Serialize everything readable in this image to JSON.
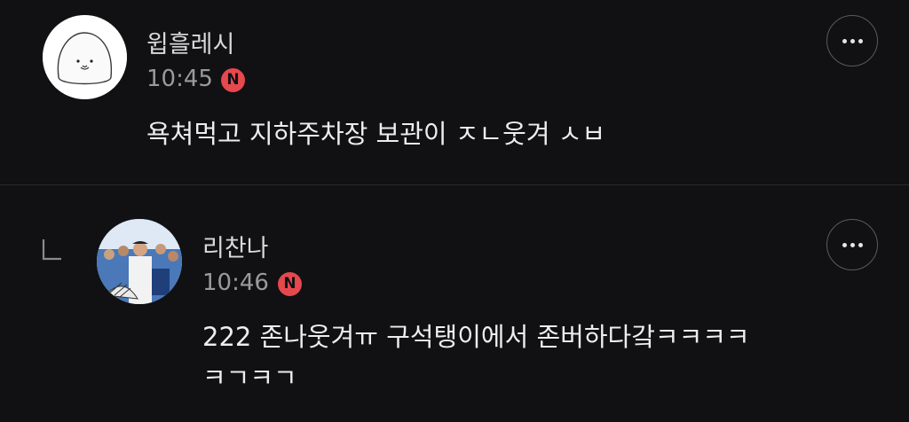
{
  "comments": [
    {
      "username": "윕흘레시",
      "time": "10:45",
      "badge": "N",
      "text": "욕쳐먹고 지하주차장 보관이 ㅈㄴ웃겨 ㅅㅂ",
      "avatar": "seal-character-avatar",
      "is_reply": false
    },
    {
      "username": "리찬나",
      "time": "10:46",
      "badge": "N",
      "text_line1": "222 존나웃겨ㅠ 구석탱이에서 존버하다갘ㅋㅋㅋㅋ",
      "text_line2": "ㅋㄱㅋㄱ",
      "avatar": "crowd-photo-avatar",
      "is_reply": true
    }
  ],
  "icons": {
    "more": "more-horizontal-icon",
    "reply": "reply-arrow-icon",
    "new_badge": "new-badge-icon"
  },
  "colors": {
    "background": "#111113",
    "badge": "#e5484d",
    "text_primary": "#ededed",
    "text_secondary": "#9a9a9a",
    "divider": "#2a2a2d"
  }
}
